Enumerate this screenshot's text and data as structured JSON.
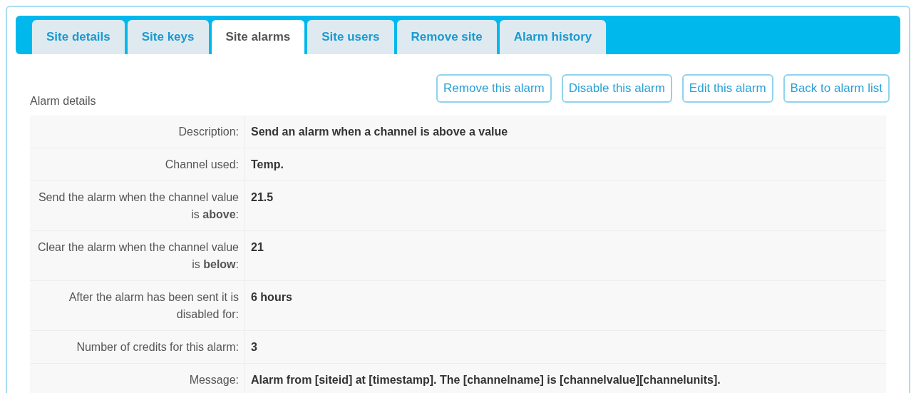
{
  "tabs": [
    {
      "label": "Site details",
      "selected": false
    },
    {
      "label": "Site keys",
      "selected": false
    },
    {
      "label": "Site alarms",
      "selected": true
    },
    {
      "label": "Site users",
      "selected": false
    },
    {
      "label": "Remove site",
      "selected": false
    },
    {
      "label": "Alarm history",
      "selected": false
    }
  ],
  "buttons": [
    "Remove this alarm",
    "Disable this alarm",
    "Edit this alarm",
    "Back to alarm list"
  ],
  "section_title": "Alarm details",
  "rows": [
    {
      "label": "Description:",
      "value": "Send an alarm when a channel is above a value"
    },
    {
      "label": "Channel used:",
      "value": "Temp."
    },
    {
      "label": "Send the alarm when the channel value is **above**:",
      "value": "21.5"
    },
    {
      "label": "Clear the alarm when the channel value is **below**:",
      "value": "21"
    },
    {
      "label": "After the alarm has been sent it is disabled for:",
      "value": "6 hours"
    },
    {
      "label": "Number of credits for this alarm:",
      "value": "3"
    },
    {
      "label": "Message:",
      "value": "Alarm from [siteid] at [timestamp]. The [channelname] is [channelvalue][channelunits]."
    }
  ]
}
